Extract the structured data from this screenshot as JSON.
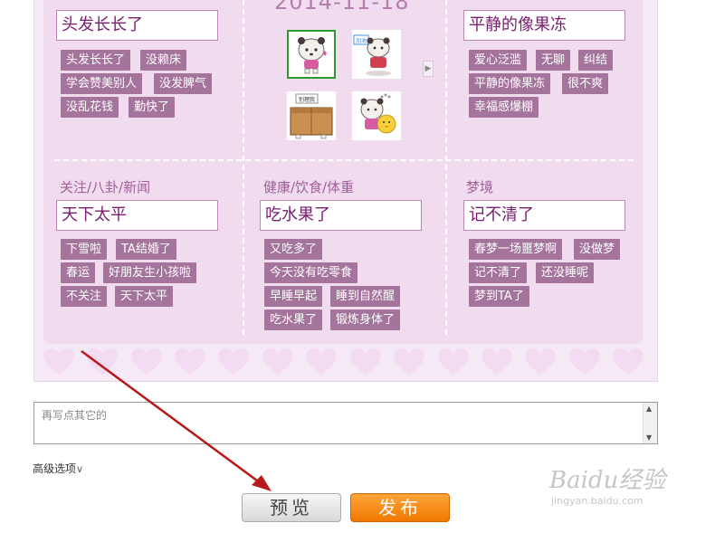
{
  "date": "2014-11-18",
  "sections": {
    "top_left": {
      "input": "头发长长了",
      "tags": [
        "头发长长了",
        "没赖床",
        "学会赞美别人",
        "没发脾气",
        "没乱花钱",
        "勤快了"
      ]
    },
    "top_right": {
      "input": "平静的像果冻",
      "tags": [
        "爱心泛滥",
        "无聊",
        "纠结",
        "平静的像果冻",
        "很不爽",
        "幸福感爆棚"
      ]
    },
    "news": {
      "title": "关注/八卦/新闻",
      "input": "天下太平",
      "tags": [
        "下雪啦",
        "TA结婚了",
        "春运",
        "好朋友生小孩啦",
        "不关注",
        "天下太平"
      ]
    },
    "health": {
      "title": "健康/饮食/体重",
      "input": "吃水果了",
      "tags": [
        "又吃多了",
        "今天没有吃零食",
        "早睡早起",
        "睡到自然醒",
        "吃水果了",
        "锻炼身体了"
      ]
    },
    "dream": {
      "title": "梦境",
      "input": "记不清了",
      "tags": [
        "春梦一场噩梦啊",
        "没做梦",
        "记不清了",
        "还没睡呢",
        "梦到TA了"
      ]
    }
  },
  "emojis": [
    {
      "name": "bear-sparkle",
      "selected": true
    },
    {
      "name": "bear-cheer",
      "selected": false,
      "sign": "加油"
    },
    {
      "name": "box",
      "selected": false,
      "sign": "别理我"
    },
    {
      "name": "bear-chick",
      "selected": false
    }
  ],
  "textarea": {
    "placeholder": "再写点其它的"
  },
  "advanced": {
    "label": "高级选项"
  },
  "buttons": {
    "preview": "预览",
    "publish": "发布"
  },
  "watermark": {
    "main": "Baidu经验",
    "sub": "jingyan.baidu.com"
  },
  "colors": {
    "tag": "#a5749d",
    "card": "#f6e9f6",
    "publish": "#f58a14",
    "selected": "#2e9a2e"
  }
}
